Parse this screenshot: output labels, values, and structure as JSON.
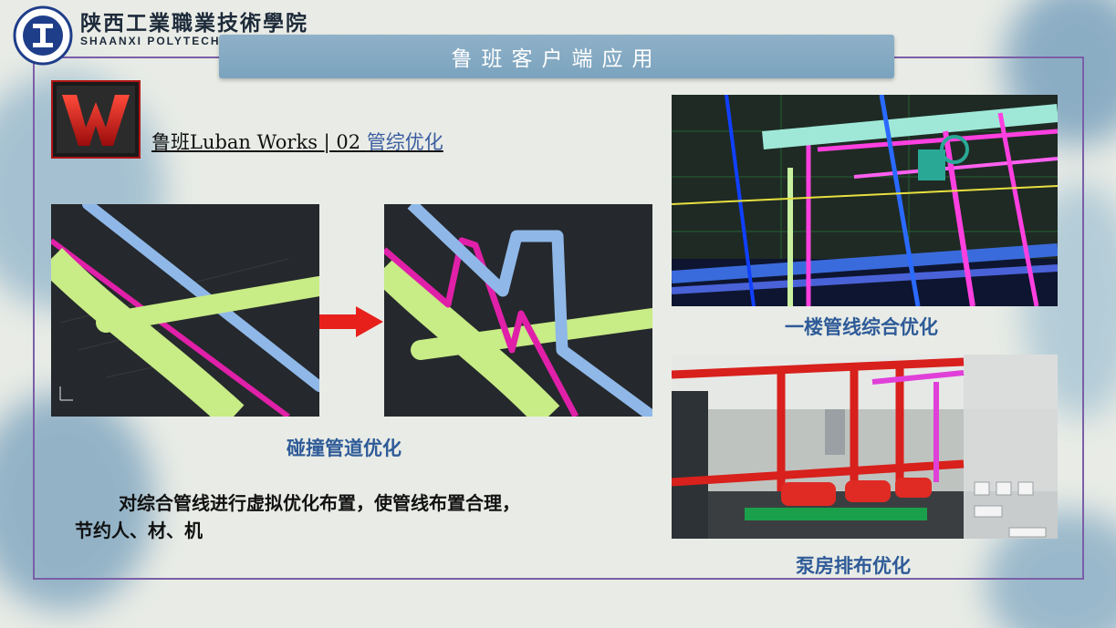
{
  "header": {
    "school_name_cn": "陕西工業職業技術學院",
    "school_name_en": "SHAANXI POLYTECHNIC INSTITUTE",
    "title": "鲁班客户端应用"
  },
  "section": {
    "title_prefix": "鲁班Luban Works | 02 ",
    "title_highlight": "管综优化"
  },
  "figures": {
    "collision": {
      "caption": "碰撞管道优化"
    },
    "floor1": {
      "caption": "一楼管线综合优化"
    },
    "pump": {
      "caption": "泵房排布优化"
    }
  },
  "description": {
    "line1": "对综合管线进行虚拟优化布置，使管线布置合理，",
    "line2": "节约人、材、机"
  },
  "colors": {
    "frame": "#7b5ea8",
    "banner": "#7ba3be",
    "caption": "#2f5b98",
    "pipe_green": "#c8ec86",
    "pipe_blue": "#8fb8e8",
    "pipe_magenta": "#e020a8",
    "arrow": "#e8201c"
  },
  "icons": [
    "school-logo-icon",
    "luban-works-app-icon",
    "right-arrow-icon"
  ]
}
